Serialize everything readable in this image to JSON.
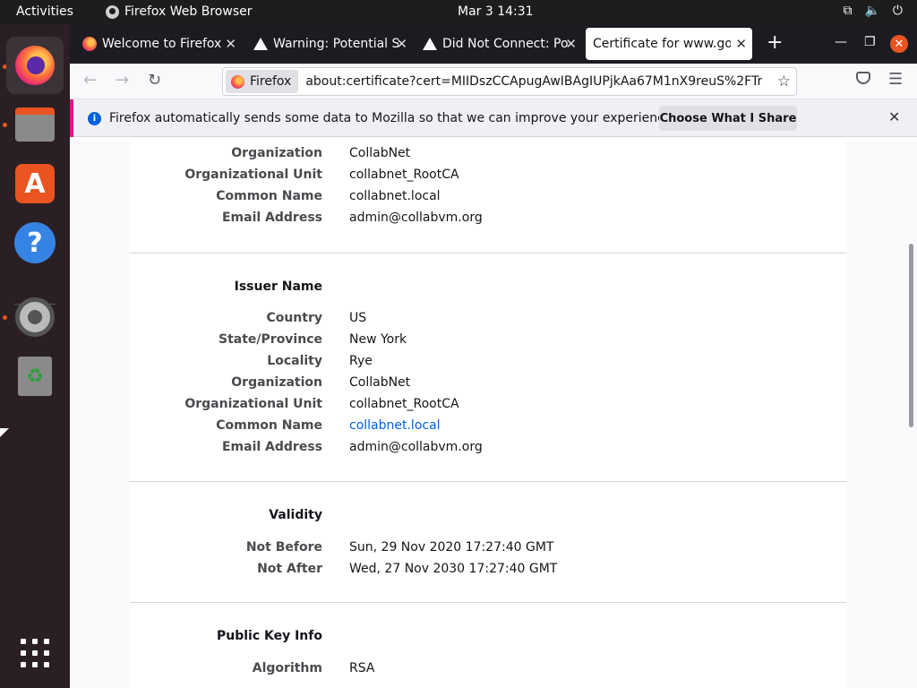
{
  "topbar": {
    "activities": "Activities",
    "app_name": "Firefox Web Browser",
    "clock": "Mar 3  14:31",
    "tray": {
      "network_icon": "network-icon",
      "volume_icon": "volume-icon",
      "power_icon": "power-icon"
    }
  },
  "dock": {
    "items": [
      "firefox",
      "files",
      "app-store",
      "help",
      "settings",
      "trash"
    ],
    "show_apps": "apps-grid-icon"
  },
  "tabs": [
    {
      "label": "Welcome to Firefox",
      "icon": "firefox-icon",
      "selected": false
    },
    {
      "label": "Warning: Potential S",
      "icon": "warning-icon",
      "selected": false
    },
    {
      "label": "Did Not Connect: Po",
      "icon": "warning-icon",
      "selected": false
    },
    {
      "label": "Certificate for www.go",
      "icon": "none",
      "selected": true
    }
  ],
  "navbar": {
    "identity_label": "Firefox",
    "url": "about:certificate?cert=MIIDszCCApugAwIBAgIUPjkAa67M1nX9reuS%2FTr"
  },
  "notification": {
    "text": "Firefox automatically sends some data to Mozilla so that we can improve your experience.",
    "button": "Choose What I Share"
  },
  "subject_partial": {
    "rows": [
      {
        "label": "Organization",
        "value": "CollabNet"
      },
      {
        "label": "Organizational Unit",
        "value": "collabnet_RootCA"
      },
      {
        "label": "Common Name",
        "value": "collabnet.local"
      },
      {
        "label": "Email Address",
        "value": "admin@collabvm.org"
      }
    ]
  },
  "issuer": {
    "title": "Issuer Name",
    "rows": [
      {
        "label": "Country",
        "value": "US"
      },
      {
        "label": "State/Province",
        "value": "New York"
      },
      {
        "label": "Locality",
        "value": "Rye"
      },
      {
        "label": "Organization",
        "value": "CollabNet"
      },
      {
        "label": "Organizational Unit",
        "value": "collabnet_RootCA"
      },
      {
        "label": "Common Name",
        "value": "collabnet.local"
      },
      {
        "label": "Email Address",
        "value": "admin@collabvm.org"
      }
    ]
  },
  "validity": {
    "title": "Validity",
    "rows": [
      {
        "label": "Not Before",
        "value": "Sun, 29 Nov 2020 17:27:40 GMT"
      },
      {
        "label": "Not After",
        "value": "Wed, 27 Nov 2030 17:27:40 GMT"
      }
    ]
  },
  "public_key": {
    "title": "Public Key Info",
    "rows": [
      {
        "label": "Algorithm",
        "value": "RSA"
      }
    ]
  }
}
